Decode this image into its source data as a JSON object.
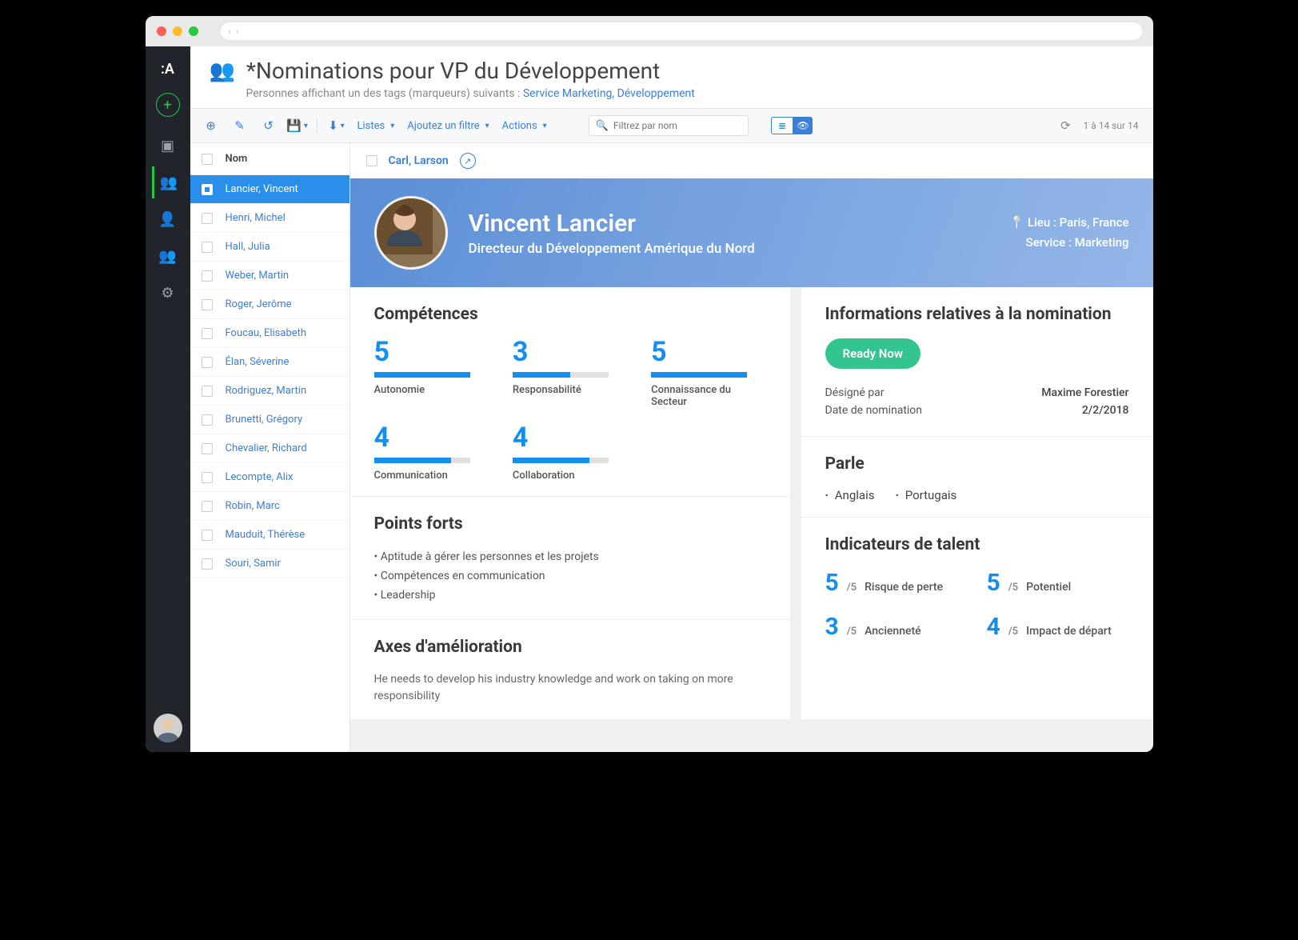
{
  "header": {
    "title": "*Nominations pour VP du Développement",
    "subtitle_prefix": "Personnes affichant un des tags (marqueurs) suivants : ",
    "subtitle_link": "Service Marketing, Développement"
  },
  "toolbar": {
    "listes": "Listes",
    "add_filter": "Ajoutez un filtre",
    "actions": "Actions",
    "search_placeholder": "Filtrez par nom",
    "count": "1 à 14 sur 14"
  },
  "list": {
    "header": "Nom",
    "items": [
      {
        "name": "Lancier, Vincent",
        "selected": true
      },
      {
        "name": "Henri, Michel"
      },
      {
        "name": "Hall, Julia"
      },
      {
        "name": "Weber, Martin"
      },
      {
        "name": "Roger, Jerôme"
      },
      {
        "name": "Foucau, Elisabeth"
      },
      {
        "name": "Élan, Séverine"
      },
      {
        "name": "Rodriguez, Martin"
      },
      {
        "name": "Brunetti, Grégory"
      },
      {
        "name": "Chevalier, Richard"
      },
      {
        "name": "Lecompte, Alix"
      },
      {
        "name": "Robin, Marc"
      },
      {
        "name": "Mauduit, Thérèse"
      },
      {
        "name": "Souri, Samir"
      }
    ]
  },
  "prev_card": {
    "name": "Carl, Larson"
  },
  "profile": {
    "name": "Vincent Lancier",
    "role": "Directeur du Développement Amérique du Nord",
    "location_label": "Lieu : Paris, France",
    "service_label": "Service : Marketing"
  },
  "competences": {
    "title": "Compétences",
    "items": [
      {
        "score": "5",
        "label": "Autonomie",
        "pct": 100
      },
      {
        "score": "3",
        "label": "Responsabilité",
        "pct": 60
      },
      {
        "score": "5",
        "label": "Connaissance du Secteur",
        "pct": 100
      },
      {
        "score": "4",
        "label": "Communication",
        "pct": 80
      },
      {
        "score": "4",
        "label": "Collaboration",
        "pct": 80
      }
    ]
  },
  "strengths": {
    "title": "Points forts",
    "items": [
      "Aptitude à gérer les personnes et les projets",
      "Compétences en communication",
      "Leadership"
    ]
  },
  "improve": {
    "title": "Axes d'amélioration",
    "text": "He needs to develop his industry knowledge and work on taking on more responsibility"
  },
  "nomination": {
    "title": "Informations relatives à la nomination",
    "badge": "Ready Now",
    "designated_k": "Désigné par",
    "designated_v": "Maxime Forestier",
    "date_k": "Date de nomination",
    "date_v": "2/2/2018"
  },
  "speaks": {
    "title": "Parle",
    "items": [
      "Anglais",
      "Portugais"
    ]
  },
  "indicators": {
    "title": "Indicateurs de talent",
    "of": "/5",
    "items": [
      {
        "score": "5",
        "label": "Risque de perte"
      },
      {
        "score": "5",
        "label": "Potentiel"
      },
      {
        "score": "3",
        "label": "Ancienneté"
      },
      {
        "score": "4",
        "label": "Impact de départ"
      }
    ]
  }
}
